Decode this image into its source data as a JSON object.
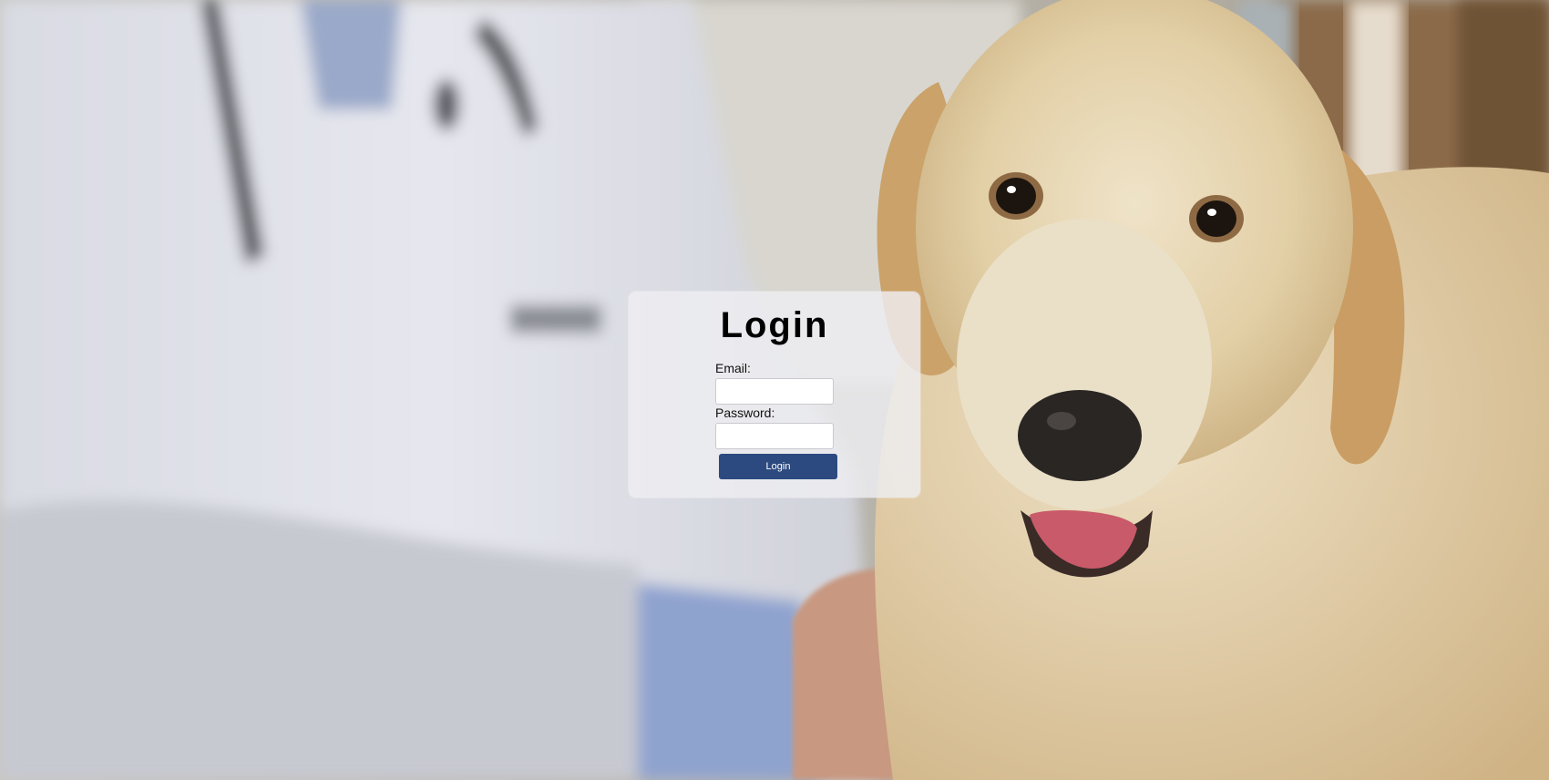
{
  "login": {
    "title": "Login",
    "email_label": "Email:",
    "email_value": "",
    "password_label": "Password:",
    "password_value": "",
    "button_label": "Login"
  },
  "colors": {
    "button_background": "#2c4a7f",
    "button_text": "#ffffff",
    "card_background": "#eeeef2"
  },
  "background": {
    "icon": "vet-and-golden-retriever-photo"
  }
}
